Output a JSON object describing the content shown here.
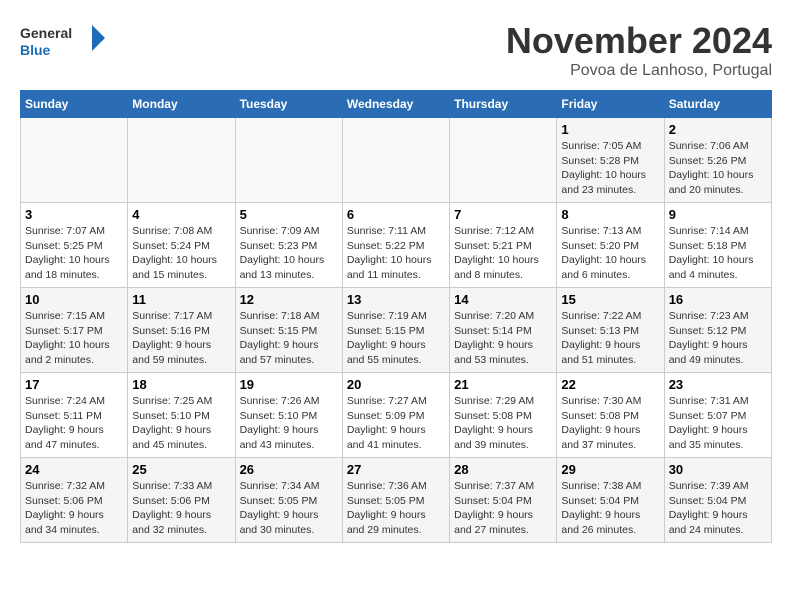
{
  "header": {
    "logo_text_general": "General",
    "logo_text_blue": "Blue",
    "month_title": "November 2024",
    "location": "Povoa de Lanhoso, Portugal"
  },
  "calendar": {
    "days_of_week": [
      "Sunday",
      "Monday",
      "Tuesday",
      "Wednesday",
      "Thursday",
      "Friday",
      "Saturday"
    ],
    "weeks": [
      [
        {
          "day": "",
          "info": ""
        },
        {
          "day": "",
          "info": ""
        },
        {
          "day": "",
          "info": ""
        },
        {
          "day": "",
          "info": ""
        },
        {
          "day": "",
          "info": ""
        },
        {
          "day": "1",
          "info": "Sunrise: 7:05 AM\nSunset: 5:28 PM\nDaylight: 10 hours and 23 minutes."
        },
        {
          "day": "2",
          "info": "Sunrise: 7:06 AM\nSunset: 5:26 PM\nDaylight: 10 hours and 20 minutes."
        }
      ],
      [
        {
          "day": "3",
          "info": "Sunrise: 7:07 AM\nSunset: 5:25 PM\nDaylight: 10 hours and 18 minutes."
        },
        {
          "day": "4",
          "info": "Sunrise: 7:08 AM\nSunset: 5:24 PM\nDaylight: 10 hours and 15 minutes."
        },
        {
          "day": "5",
          "info": "Sunrise: 7:09 AM\nSunset: 5:23 PM\nDaylight: 10 hours and 13 minutes."
        },
        {
          "day": "6",
          "info": "Sunrise: 7:11 AM\nSunset: 5:22 PM\nDaylight: 10 hours and 11 minutes."
        },
        {
          "day": "7",
          "info": "Sunrise: 7:12 AM\nSunset: 5:21 PM\nDaylight: 10 hours and 8 minutes."
        },
        {
          "day": "8",
          "info": "Sunrise: 7:13 AM\nSunset: 5:20 PM\nDaylight: 10 hours and 6 minutes."
        },
        {
          "day": "9",
          "info": "Sunrise: 7:14 AM\nSunset: 5:18 PM\nDaylight: 10 hours and 4 minutes."
        }
      ],
      [
        {
          "day": "10",
          "info": "Sunrise: 7:15 AM\nSunset: 5:17 PM\nDaylight: 10 hours and 2 minutes."
        },
        {
          "day": "11",
          "info": "Sunrise: 7:17 AM\nSunset: 5:16 PM\nDaylight: 9 hours and 59 minutes."
        },
        {
          "day": "12",
          "info": "Sunrise: 7:18 AM\nSunset: 5:15 PM\nDaylight: 9 hours and 57 minutes."
        },
        {
          "day": "13",
          "info": "Sunrise: 7:19 AM\nSunset: 5:15 PM\nDaylight: 9 hours and 55 minutes."
        },
        {
          "day": "14",
          "info": "Sunrise: 7:20 AM\nSunset: 5:14 PM\nDaylight: 9 hours and 53 minutes."
        },
        {
          "day": "15",
          "info": "Sunrise: 7:22 AM\nSunset: 5:13 PM\nDaylight: 9 hours and 51 minutes."
        },
        {
          "day": "16",
          "info": "Sunrise: 7:23 AM\nSunset: 5:12 PM\nDaylight: 9 hours and 49 minutes."
        }
      ],
      [
        {
          "day": "17",
          "info": "Sunrise: 7:24 AM\nSunset: 5:11 PM\nDaylight: 9 hours and 47 minutes."
        },
        {
          "day": "18",
          "info": "Sunrise: 7:25 AM\nSunset: 5:10 PM\nDaylight: 9 hours and 45 minutes."
        },
        {
          "day": "19",
          "info": "Sunrise: 7:26 AM\nSunset: 5:10 PM\nDaylight: 9 hours and 43 minutes."
        },
        {
          "day": "20",
          "info": "Sunrise: 7:27 AM\nSunset: 5:09 PM\nDaylight: 9 hours and 41 minutes."
        },
        {
          "day": "21",
          "info": "Sunrise: 7:29 AM\nSunset: 5:08 PM\nDaylight: 9 hours and 39 minutes."
        },
        {
          "day": "22",
          "info": "Sunrise: 7:30 AM\nSunset: 5:08 PM\nDaylight: 9 hours and 37 minutes."
        },
        {
          "day": "23",
          "info": "Sunrise: 7:31 AM\nSunset: 5:07 PM\nDaylight: 9 hours and 35 minutes."
        }
      ],
      [
        {
          "day": "24",
          "info": "Sunrise: 7:32 AM\nSunset: 5:06 PM\nDaylight: 9 hours and 34 minutes."
        },
        {
          "day": "25",
          "info": "Sunrise: 7:33 AM\nSunset: 5:06 PM\nDaylight: 9 hours and 32 minutes."
        },
        {
          "day": "26",
          "info": "Sunrise: 7:34 AM\nSunset: 5:05 PM\nDaylight: 9 hours and 30 minutes."
        },
        {
          "day": "27",
          "info": "Sunrise: 7:36 AM\nSunset: 5:05 PM\nDaylight: 9 hours and 29 minutes."
        },
        {
          "day": "28",
          "info": "Sunrise: 7:37 AM\nSunset: 5:04 PM\nDaylight: 9 hours and 27 minutes."
        },
        {
          "day": "29",
          "info": "Sunrise: 7:38 AM\nSunset: 5:04 PM\nDaylight: 9 hours and 26 minutes."
        },
        {
          "day": "30",
          "info": "Sunrise: 7:39 AM\nSunset: 5:04 PM\nDaylight: 9 hours and 24 minutes."
        }
      ]
    ]
  }
}
